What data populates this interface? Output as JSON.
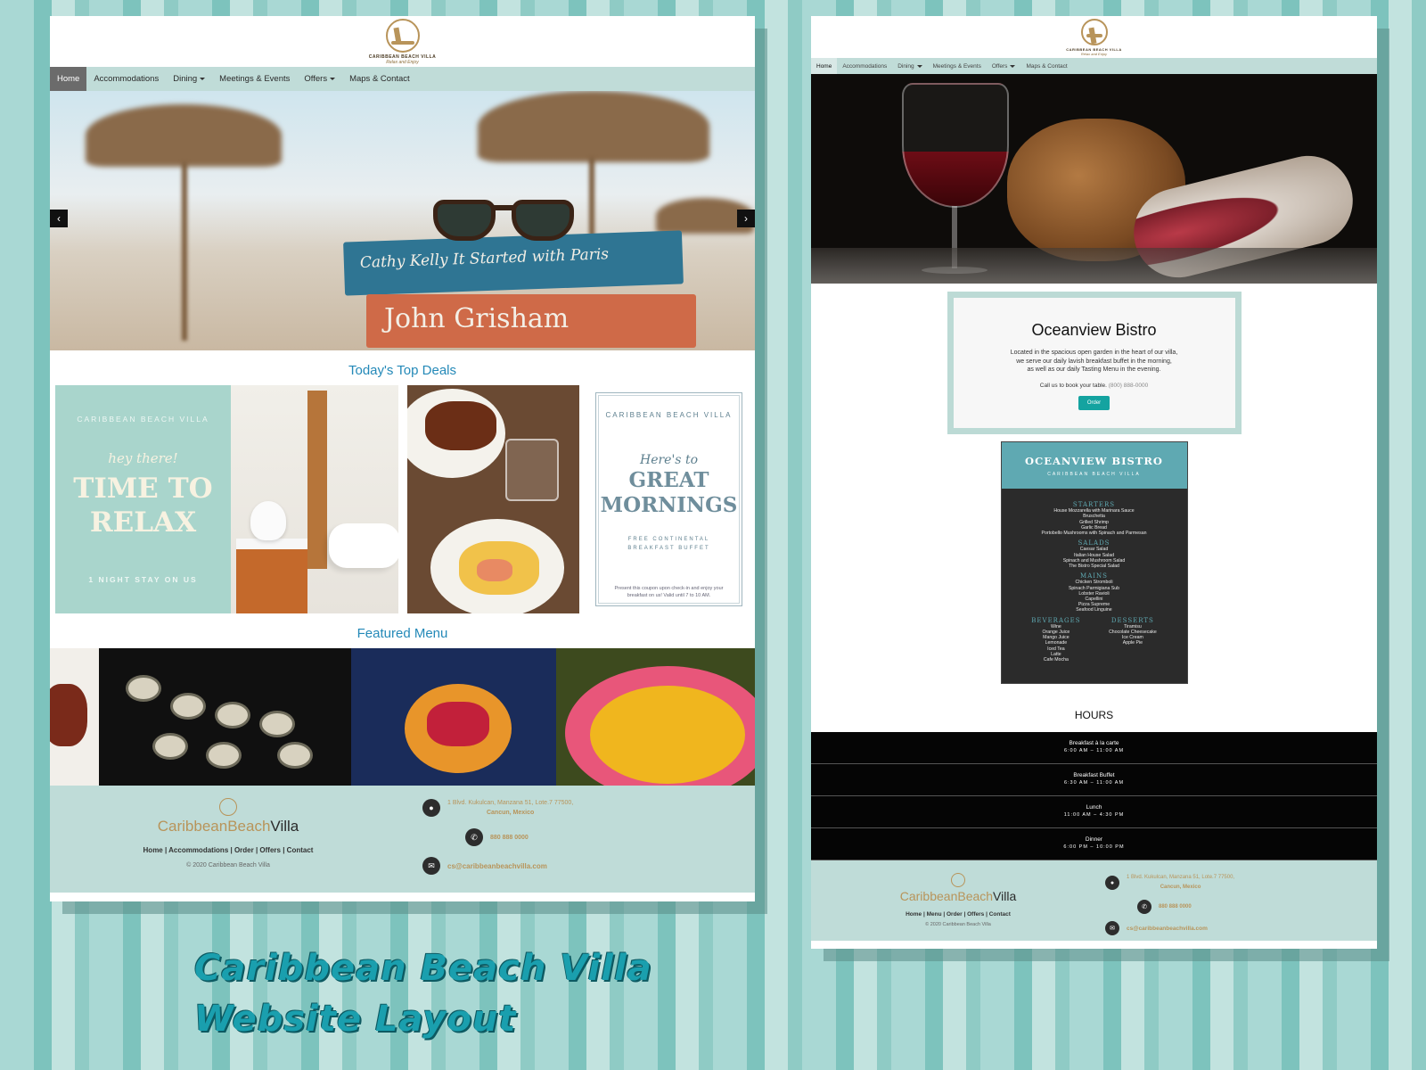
{
  "brand": {
    "name": "CARIBBEAN BEACH VILLA",
    "tagline": "Relax and Enjoy",
    "wordmark_a": "CaribbeanBeach",
    "wordmark_b": "Villa",
    "gold": "#b8945a",
    "teal": "#14a3a0"
  },
  "left_page": {
    "nav": {
      "items": [
        {
          "label": "Home",
          "active": true
        },
        {
          "label": "Accommodations"
        },
        {
          "label": "Dining",
          "dropdown": true
        },
        {
          "label": "Meetings & Events"
        },
        {
          "label": "Offers",
          "dropdown": true
        },
        {
          "label": "Maps & Contact"
        }
      ]
    },
    "hero": {
      "prev": "‹",
      "next": "›",
      "book_top": "Cathy Kelly   It Started with Paris",
      "book_bottom": "John Grisham"
    },
    "deals": {
      "title": "Today's Top Deals",
      "relax": {
        "brand": "CARIBBEAN BEACH VILLA",
        "hey": "hey there!",
        "line1": "TIME TO",
        "line2": "RELAX",
        "stay": "1 NIGHT STAY ON US"
      },
      "mornings": {
        "brand": "CARIBBEAN BEACH VILLA",
        "here": "Here's to",
        "line1": "GREAT",
        "line2": "MORNINGS",
        "free": "FREE CONTINENTAL",
        "buffet": "BREAKFAST BUFFET",
        "note": "Present this coupon upon check-in and enjoy your breakfast on us! Valid until 7 to 10 AM."
      }
    },
    "menu": {
      "title": "Featured Menu"
    },
    "footer": {
      "links": "Home | Accommodations | Order | Offers | Contact",
      "copyright": "© 2020 Caribbean Beach Villa",
      "address1": "1 Blvd. Kukulcan, Manzana 51, Lote.7 77500,",
      "address2": "Cancun, Mexico",
      "phone": "880 888 0000",
      "email": "cs@caribbeanbeachvilla.com"
    }
  },
  "right_page": {
    "nav": {
      "items": [
        {
          "label": "Home",
          "active": true
        },
        {
          "label": "Accommodations"
        },
        {
          "label": "Dining",
          "dropdown": true
        },
        {
          "label": "Meetings & Events"
        },
        {
          "label": "Offers",
          "dropdown": true
        },
        {
          "label": "Maps & Contact"
        }
      ]
    },
    "bistro": {
      "title": "Oceanview Bistro",
      "desc1": "Located in the spacious open garden in the heart of our villa,",
      "desc2": "we serve our daily lavish breakfast buffet in the morning,",
      "desc3": "as well as our daily Tasting Menu in the evening.",
      "call": "Call us to book your table.",
      "phone": "(800) 888-0000",
      "order": "Order"
    },
    "menu_card": {
      "title": "OCEANVIEW BISTRO",
      "subtitle": "CARIBBEAN BEACH VILLA",
      "sections": [
        {
          "name": "STARTERS",
          "items": [
            "House Mozzarella with Marinara Sauce",
            "Bruschetta",
            "Grilled Shrimp",
            "Garlic Bread",
            "Portobello Mushrooms with Spinach and Parmesan"
          ]
        },
        {
          "name": "SALADS",
          "items": [
            "Caesar Salad",
            "Italian House Salad",
            "Spinach and Mushroom Salad",
            "The Bistro Special Salad"
          ]
        },
        {
          "name": "MAINS",
          "items": [
            "Chicken Stromboli",
            "Spinach Parmigiana Sub",
            "Lobster Ravioli",
            "Capellini",
            "Pizza Supreme",
            "Seafood Linguine"
          ]
        }
      ],
      "beverages": {
        "name": "BEVERAGES",
        "items": [
          "Wine",
          "Orange Juice",
          "Mango Juice",
          "Lemonade",
          "Iced Tea",
          "Latte",
          "Cafe Mocha"
        ]
      },
      "desserts": {
        "name": "DESSERTS",
        "items": [
          "Tiramisu",
          "Chocolate Cheesecake",
          "Ice Cream",
          "Apple Pie"
        ]
      }
    },
    "hours": {
      "title": "HOURS",
      "rows": [
        {
          "name": "Breakfast à la carte",
          "time": "6:00 AM – 11:00 AM"
        },
        {
          "name": "Breakfast Buffet",
          "time": "6:30 AM – 11:00 AM"
        },
        {
          "name": "Lunch",
          "time": "11:00 AM – 4:30 PM"
        },
        {
          "name": "Dinner",
          "time": "6:00 PM – 10:00 PM"
        }
      ]
    },
    "footer": {
      "links": "Home | Menu | Order | Offers | Contact",
      "copyright": "© 2020 Caribbean Beach Villa",
      "address1": "1 Blvd. Kukulcan, Manzana 51, Lote.7 77500,",
      "address2": "Cancun, Mexico",
      "phone": "880 888 0000",
      "email": "cs@caribbeanbeachvilla.com"
    }
  },
  "caption": {
    "line1": "Caribbean Beach Villa",
    "line2": "Website Layout"
  }
}
